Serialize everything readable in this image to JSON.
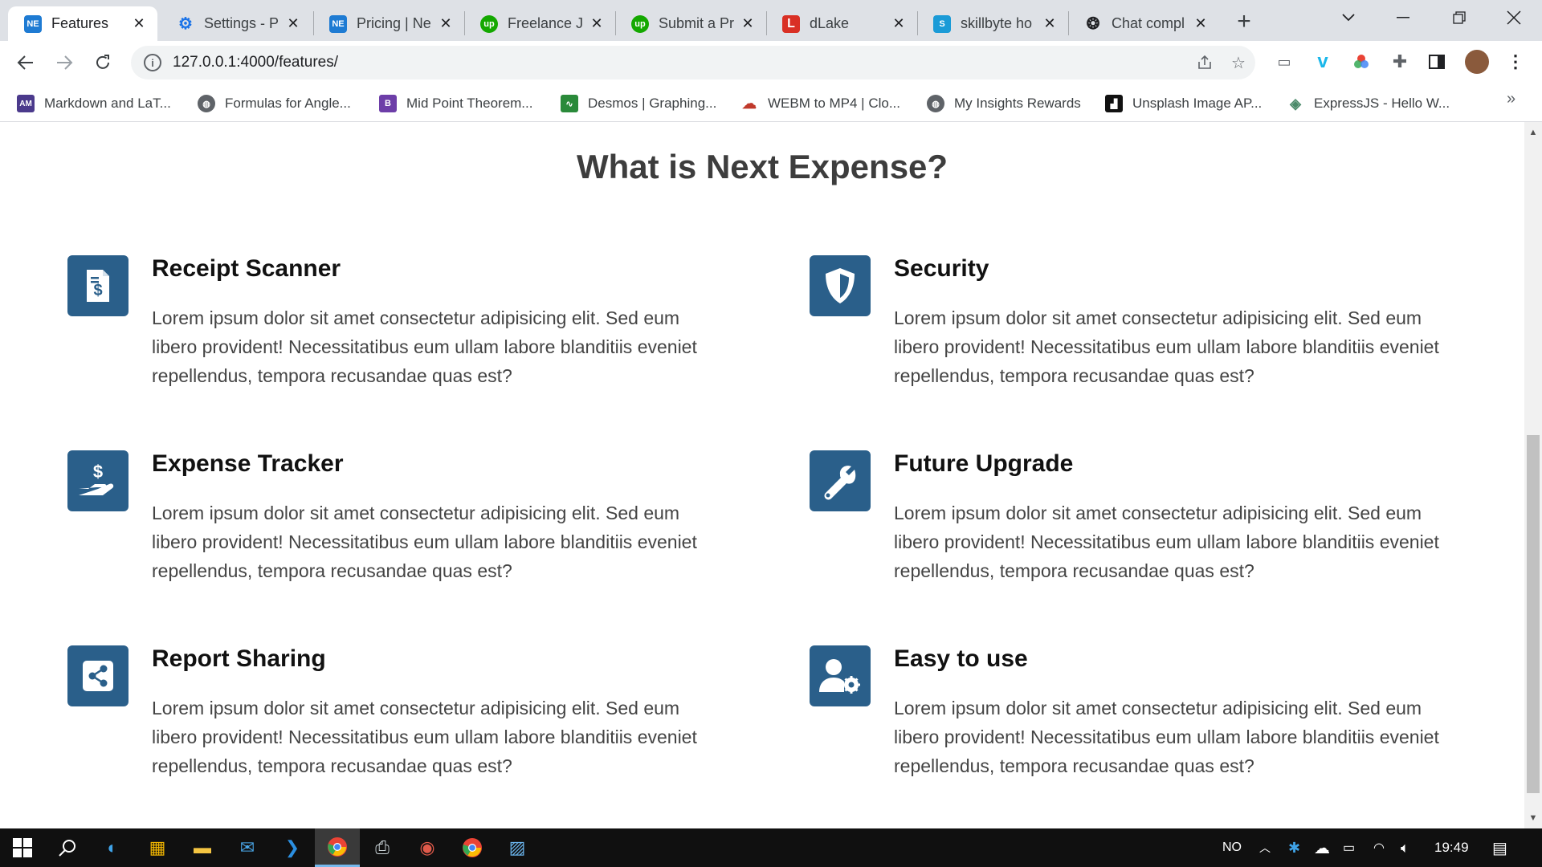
{
  "browser": {
    "tabs": [
      {
        "title": "Features",
        "favicon": "NE",
        "favicon_color": "#1e7bd3",
        "active": true
      },
      {
        "title": "Settings - P",
        "favicon": "gear-icon",
        "favicon_color": "#1a73e8"
      },
      {
        "title": "Pricing | Ne",
        "favicon": "NE",
        "favicon_color": "#1e7bd3"
      },
      {
        "title": "Freelance J",
        "favicon": "up",
        "favicon_color": "#14a800"
      },
      {
        "title": "Submit a Pr",
        "favicon": "up",
        "favicon_color": "#14a800"
      },
      {
        "title": "dLake",
        "favicon": "L",
        "favicon_color": "#d93025"
      },
      {
        "title": "skillbyte ho",
        "favicon": "S",
        "favicon_color": "#1b9bd7"
      },
      {
        "title": "Chat compl",
        "favicon": "openai-icon",
        "favicon_color": "#202124"
      }
    ],
    "url": "127.0.0.1:4000/features/",
    "bookmarks": [
      {
        "label": "Markdown and LaT...",
        "icon": "AM",
        "color": "#4b3a8c"
      },
      {
        "label": "Formulas for Angle...",
        "icon": "globe-icon",
        "color": "#5f6368"
      },
      {
        "label": "Mid Point Theorem...",
        "icon": "B",
        "color": "#6d3ea8"
      },
      {
        "label": "Desmos | Graphing...",
        "icon": "chart-icon",
        "color": "#2a8a3a"
      },
      {
        "label": "WEBM to MP4 | Clo...",
        "icon": "cloud-icon",
        "color": "#c0392b"
      },
      {
        "label": "My Insights Rewards",
        "icon": "globe-icon",
        "color": "#5f6368"
      },
      {
        "label": "Unsplash Image AP...",
        "icon": "unsplash-icon",
        "color": "#111111"
      },
      {
        "label": "ExpressJS - Hello W...",
        "icon": "diamond-icon",
        "color": "#4b8a6a"
      }
    ]
  },
  "page": {
    "title": "What is Next Expense?",
    "features": [
      {
        "title": "Receipt Scanner",
        "icon": "receipt-icon",
        "description": "Lorem ipsum dolor sit amet consectetur adipisicing elit. Sed eum libero provident! Necessitatibus eum ullam labore blanditiis eveniet repellendus, tempora recusandae quas est?"
      },
      {
        "title": "Security",
        "icon": "shield-icon",
        "description": "Lorem ipsum dolor sit amet consectetur adipisicing elit. Sed eum libero provident! Necessitatibus eum ullam labore blanditiis eveniet repellendus, tempora recusandae quas est?"
      },
      {
        "title": "Expense Tracker",
        "icon": "hand-dollar-icon",
        "description": "Lorem ipsum dolor sit amet consectetur adipisicing elit. Sed eum libero provident! Necessitatibus eum ullam labore blanditiis eveniet repellendus, tempora recusandae quas est?"
      },
      {
        "title": "Future Upgrade",
        "icon": "wrench-icon",
        "description": "Lorem ipsum dolor sit amet consectetur adipisicing elit. Sed eum libero provident! Necessitatibus eum ullam labore blanditiis eveniet repellendus, tempora recusandae quas est?"
      },
      {
        "title": "Report Sharing",
        "icon": "share-icon",
        "description": "Lorem ipsum dolor sit amet consectetur adipisicing elit. Sed eum libero provident! Necessitatibus eum ullam labore blanditiis eveniet repellendus, tempora recusandae quas est?"
      },
      {
        "title": "Easy to use",
        "icon": "user-gear-icon",
        "description": "Lorem ipsum dolor sit amet consectetur adipisicing elit. Sed eum libero provident! Necessitatibus eum ullam labore blanditiis eveniet repellendus, tempora recusandae quas est?"
      }
    ],
    "icon_color": "#2a5f8a"
  },
  "taskbar": {
    "language": "NO",
    "time": "19:49"
  }
}
